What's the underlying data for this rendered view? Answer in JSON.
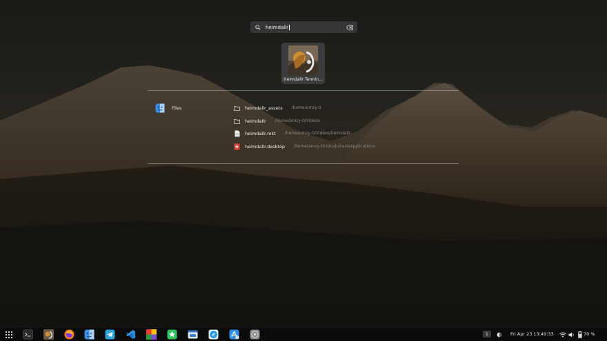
{
  "search": {
    "query": "heimdallr"
  },
  "app_results": [
    {
      "name": "Heimdallr Termin..."
    }
  ],
  "provider": {
    "label": "Files",
    "icon": "files-app-icon"
  },
  "files": [
    {
      "name": "heimdallr_assets",
      "path": "/home/amzy-0",
      "icon": "folder-icon"
    },
    {
      "name": "heimdallr",
      "path": "/home/amzy-0/Videos",
      "icon": "folder-icon"
    },
    {
      "name": "heimdallr.mkt",
      "path": "/home/amzy-0/Videos/heimdallr",
      "icon": "text-file-icon"
    },
    {
      "name": "heimdallr.desktop",
      "path": "/home/amzy-0/.local/share/applications",
      "icon": "desktop-file-icon"
    }
  ],
  "taskbar": {
    "apps": [
      "app-grid-icon",
      "terminal-icon",
      "heimdallr-icon",
      "firefox-icon",
      "finder-icon",
      "telegram-icon",
      "vscode-icon",
      "color-palette-icon",
      "starred-icon",
      "software-center-icon",
      "safari-icon",
      "app-store-icon",
      "settings-icon"
    ],
    "workspace": "1",
    "datetime": "Fri Apr 23  13:49:33",
    "battery": "70 %"
  },
  "colors": {
    "accent": "#3b8ee6",
    "background": "#15140f",
    "taskbar": "#0b0b0c"
  }
}
